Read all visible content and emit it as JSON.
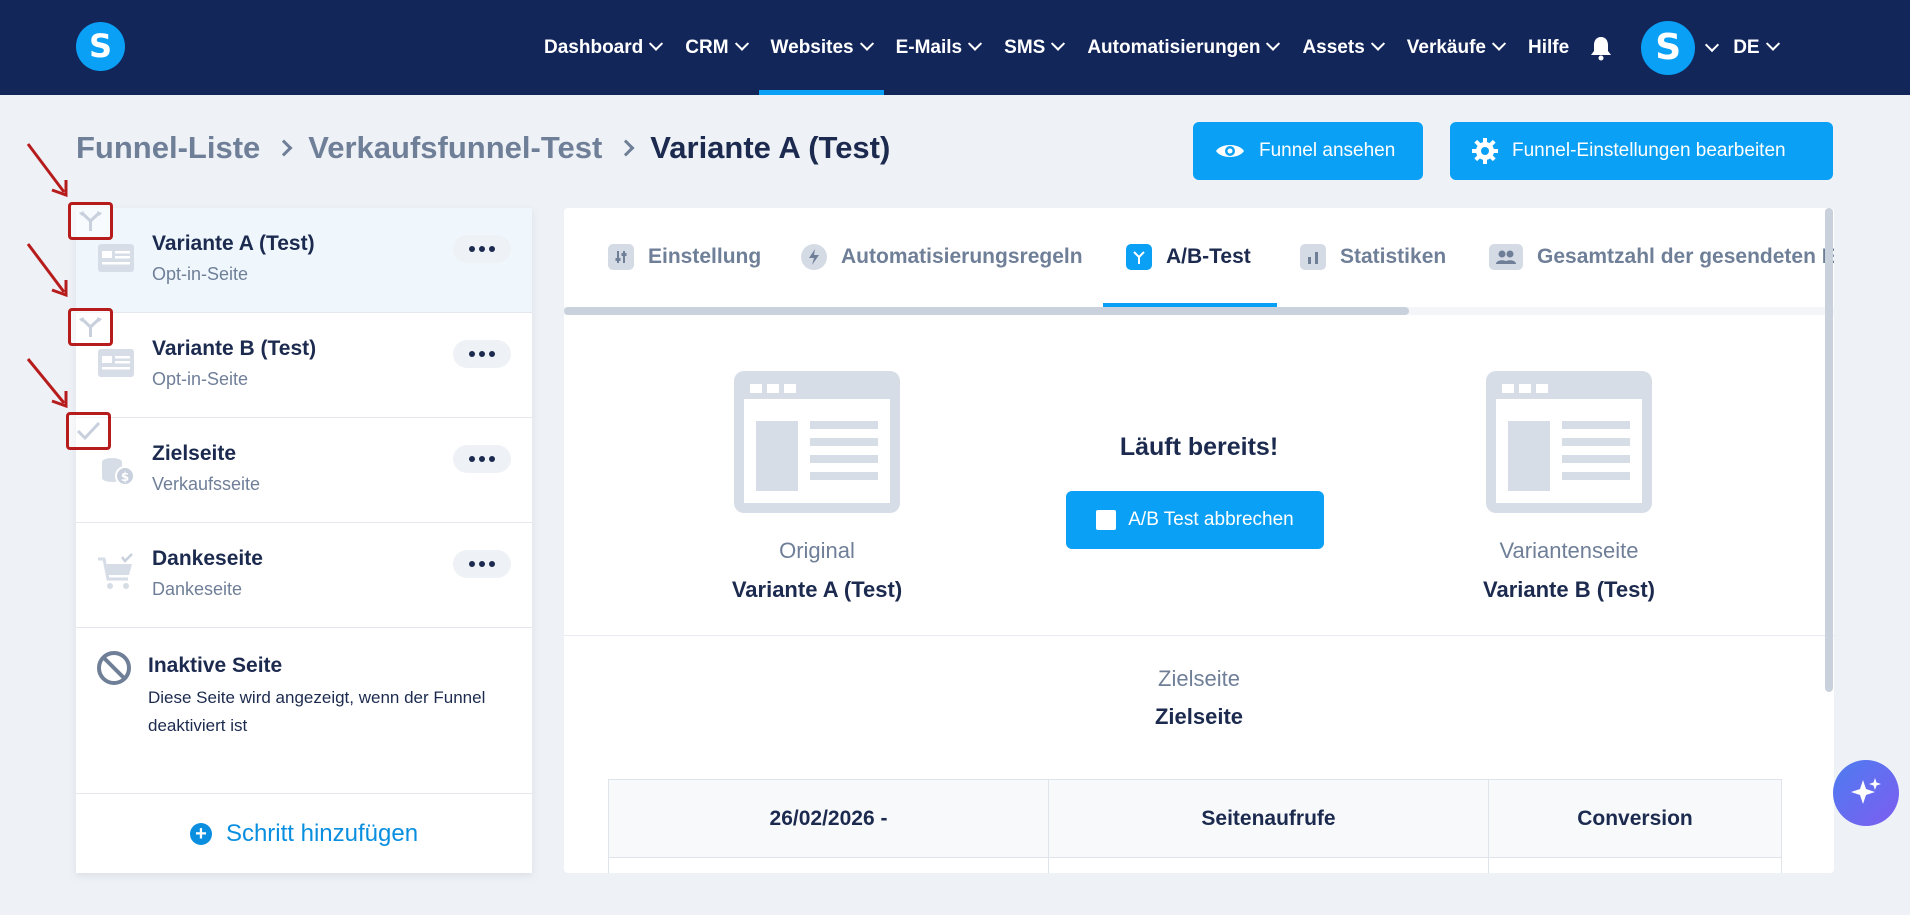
{
  "nav": {
    "items": [
      {
        "label": "Dashboard",
        "has_menu": true,
        "active": false
      },
      {
        "label": "CRM",
        "has_menu": true,
        "active": false
      },
      {
        "label": "Websites",
        "has_menu": true,
        "active": true
      },
      {
        "label": "E-Mails",
        "has_menu": true,
        "active": false
      },
      {
        "label": "SMS",
        "has_menu": true,
        "active": false
      },
      {
        "label": "Automatisierungen",
        "has_menu": true,
        "active": false
      },
      {
        "label": "Assets",
        "has_menu": true,
        "active": false
      },
      {
        "label": "Verkäufe",
        "has_menu": true,
        "active": false
      },
      {
        "label": "Hilfe",
        "has_menu": false,
        "active": false
      }
    ],
    "logo_letter": "S",
    "avatar_letter": "S",
    "language": "DE"
  },
  "breadcrumb": {
    "items": [
      "Funnel-Liste",
      "Verkaufsfunnel-Test"
    ],
    "current": "Variante A (Test)"
  },
  "actions": {
    "view_funnel": "Funnel ansehen",
    "edit_settings": "Funnel-Einstellungen bearbeiten"
  },
  "sidebar": {
    "steps": [
      {
        "title": "Variante A (Test)",
        "subtitle": "Opt-in-Seite",
        "icon": "optin-page-icon",
        "selected": true
      },
      {
        "title": "Variante B (Test)",
        "subtitle": "Opt-in-Seite",
        "icon": "optin-page-icon",
        "selected": false
      },
      {
        "title": "Zielseite",
        "subtitle": "Verkaufsseite",
        "icon": "sales-page-icon",
        "selected": false
      },
      {
        "title": "Dankeseite",
        "subtitle": "Dankeseite",
        "icon": "cart-icon",
        "selected": false
      }
    ],
    "inactive": {
      "title": "Inaktive Seite",
      "description": "Diese Seite wird angezeigt, wenn der Funnel deaktiviert ist"
    },
    "add_step": "Schritt hinzufügen"
  },
  "tabs": [
    {
      "label": "Einstellung",
      "icon": "sliders-icon",
      "active": false
    },
    {
      "label": "Automatisierungsregeln",
      "icon": "bolt-icon",
      "active": false
    },
    {
      "label": "A/B-Test",
      "icon": "split-icon",
      "active": true
    },
    {
      "label": "Statistiken",
      "icon": "chart-icon",
      "active": false
    },
    {
      "label": "Gesamtzahl der gesendeten E",
      "icon": "users-icon",
      "active": false
    }
  ],
  "ab_test": {
    "original_label": "Original",
    "original_name": "Variante A (Test)",
    "variant_label": "Variantenseite",
    "variant_name": "Variante B (Test)",
    "status": "Läuft bereits!",
    "cancel_button": "A/B Test abbrechen",
    "goal_label": "Zielseite",
    "goal_name": "Zielseite"
  },
  "table": {
    "headers": [
      "26/02/2026 -",
      "Seitenaufrufe",
      "Conversion"
    ]
  },
  "colors": {
    "nav_bg": "#13265a",
    "accent": "#0aa0f5",
    "annotation": "#b71c1c"
  }
}
